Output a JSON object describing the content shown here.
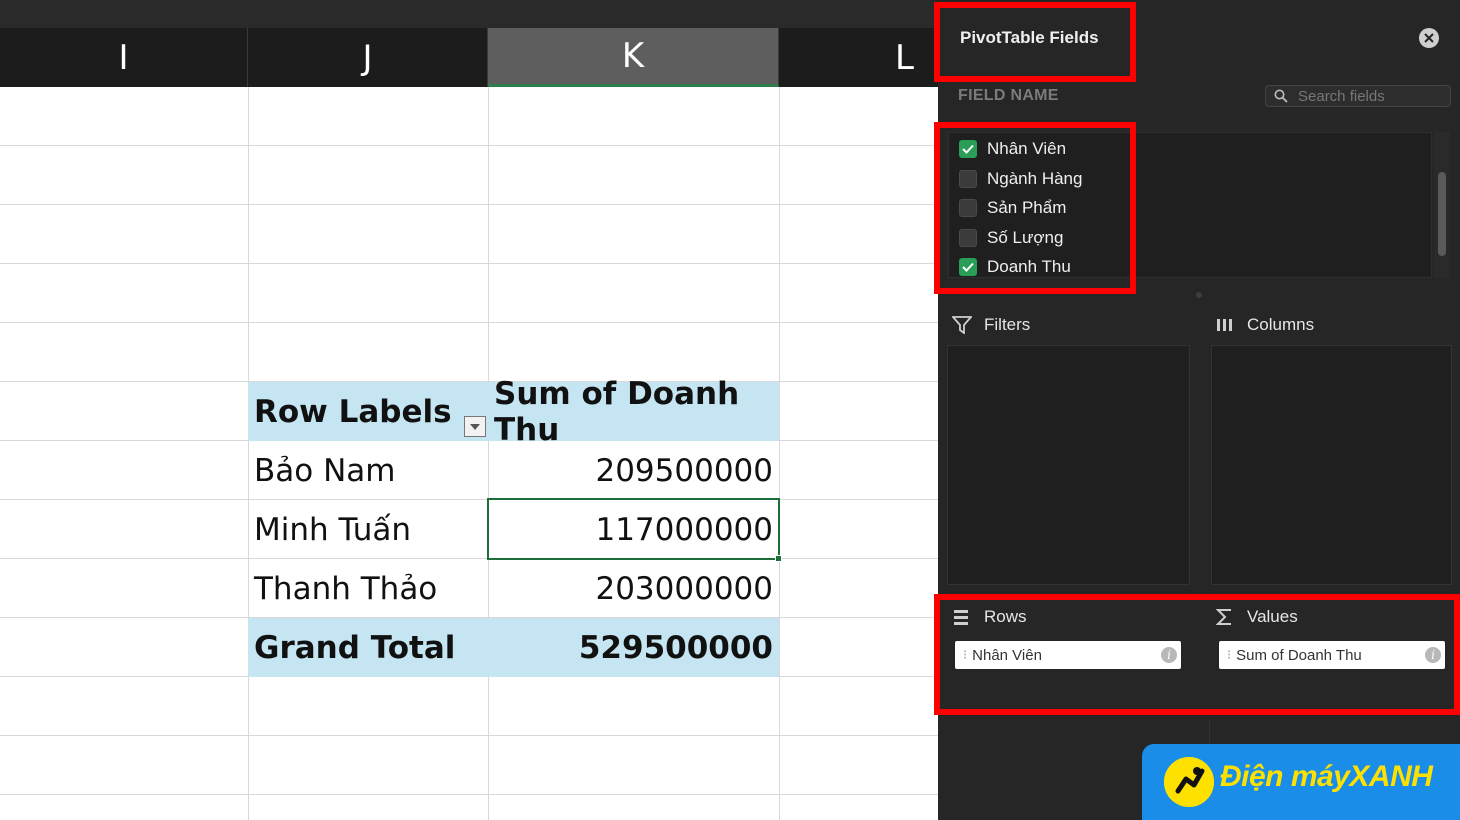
{
  "sheet": {
    "columns": [
      {
        "letter": "I",
        "selected": false
      },
      {
        "letter": "J",
        "selected": false
      },
      {
        "letter": "K",
        "selected": true
      },
      {
        "letter": "L",
        "selected": false
      }
    ],
    "pivot": {
      "header": {
        "label": "Row Labels",
        "value": "Sum of Doanh Thu"
      },
      "rows": [
        {
          "label": "Bảo Nam",
          "value": "209500000"
        },
        {
          "label": "Minh Tuấn",
          "value": "117000000"
        },
        {
          "label": "Thanh Thảo",
          "value": "203000000"
        }
      ],
      "total": {
        "label": "Grand Total",
        "value": "529500000"
      },
      "header_fill": "#c5e5f2",
      "active_cell": "117000000"
    }
  },
  "panel": {
    "title": "PivotTable Fields",
    "field_name_heading": "FIELD NAME",
    "search_placeholder": "Search fields",
    "fields": [
      {
        "label": "Nhân Viên",
        "checked": true
      },
      {
        "label": "Ngành Hàng",
        "checked": false
      },
      {
        "label": "Sản Phẩm",
        "checked": false
      },
      {
        "label": "Số Lượng",
        "checked": false
      },
      {
        "label": "Doanh Thu",
        "checked": true
      }
    ],
    "areas": {
      "filters": {
        "label": "Filters"
      },
      "columns": {
        "label": "Columns"
      },
      "rows": {
        "label": "Rows",
        "item": "Nhân Viên"
      },
      "values": {
        "label": "Values",
        "item": "Sum of Doanh Thu"
      }
    },
    "info_glyph": "i",
    "check_color": "#2a9d56"
  },
  "annotation_color": "#ff0000",
  "watermark": {
    "text": "Điện máyXANH",
    "bg": "#1a8de8",
    "fg": "#ffe100"
  }
}
